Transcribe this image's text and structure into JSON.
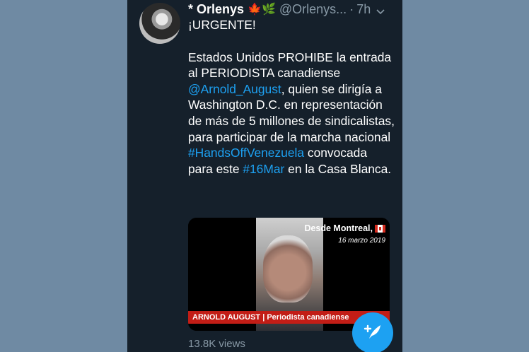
{
  "tweet": {
    "display_name": "* Orlenys",
    "name_emojis": "🍁🌿",
    "handle": "@Orlenys...",
    "separator": "·",
    "time": "7h",
    "heading": "¡URGENTE!",
    "lines": [
      {
        "before": "Estados Unidos PROHIBE la entrada al PERIODISTA canadiense "
      },
      {
        "mention": "@Arnold_August"
      },
      {
        "after": ", quien se dirigía a Washington D.C. en representación de más de 5 millones de sindicalistas, para participar de la marcha nacional "
      },
      {
        "hashtag1": "#HandsOffVenezuela"
      },
      {
        "mid": " convocada para este "
      },
      {
        "hashtag2": "#16Mar"
      },
      {
        "end": " en la Casa Blanca."
      }
    ],
    "views": "13.8K views"
  },
  "media": {
    "location": "Desde Montreal,",
    "date": "16 marzo 2019",
    "caption": "ARNOLD AUGUST | Periodista canadiense"
  },
  "colors": {
    "background": "#15202b",
    "link": "#1da1f2",
    "muted": "#8899a6",
    "lower_third": "#c21d16"
  },
  "icons": {
    "caret": "chevron-down-icon",
    "compose": "compose-tweet-icon"
  }
}
